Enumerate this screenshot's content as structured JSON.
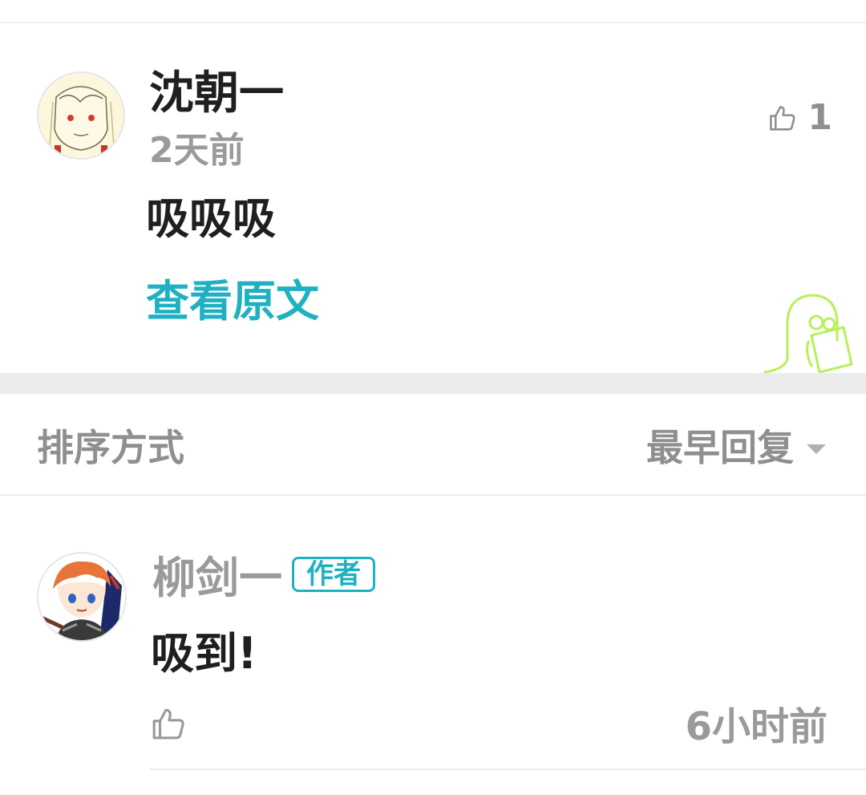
{
  "comment": {
    "author": "沈朝一",
    "time": "2天前",
    "content": "吸吸吸",
    "view_original": "查看原文",
    "like_count": "1"
  },
  "sort": {
    "label": "排序方式",
    "value": "最早回复"
  },
  "reply": {
    "author": "柳剑一",
    "badge": "作者",
    "content": "吸到!",
    "time": "6小时前"
  },
  "colors": {
    "accent": "#1fb1c2",
    "muted": "#9a9a9a",
    "text": "#1f1f1f",
    "mascot": "#b8f05a"
  }
}
